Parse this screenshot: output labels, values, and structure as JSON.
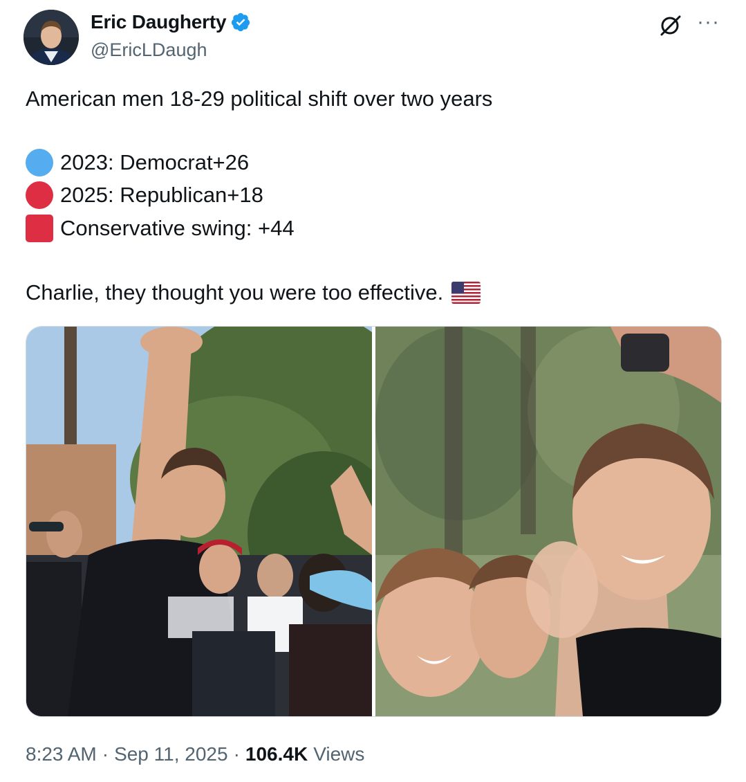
{
  "author": {
    "name": "Eric Daugherty",
    "handle": "@EricLDaugh",
    "verified": true,
    "verified_color": "#1d9bf0"
  },
  "tweet": {
    "headline": "American men 18-29 political shift over two years",
    "stats": [
      {
        "icon": "blue-circle-icon",
        "color": "#55acee",
        "text": "2023: Democrat+26"
      },
      {
        "icon": "red-circle-icon",
        "color": "#dd2e44",
        "text": "2025: Republican+18"
      },
      {
        "icon": "red-square-icon",
        "color": "#dd2e44",
        "text": "Conservative swing: +44"
      }
    ],
    "closing": "Charlie, they thought you were too effective.",
    "closing_emoji": "us-flag-icon"
  },
  "meta": {
    "time": "8:23 AM",
    "sep1": "·",
    "date": "Sep 11, 2025",
    "sep2": "·",
    "views_count": "106.4K",
    "views_label": "Views"
  },
  "colors": {
    "text": "#0f1419",
    "secondary": "#536471",
    "accent": "#1d9bf0"
  }
}
